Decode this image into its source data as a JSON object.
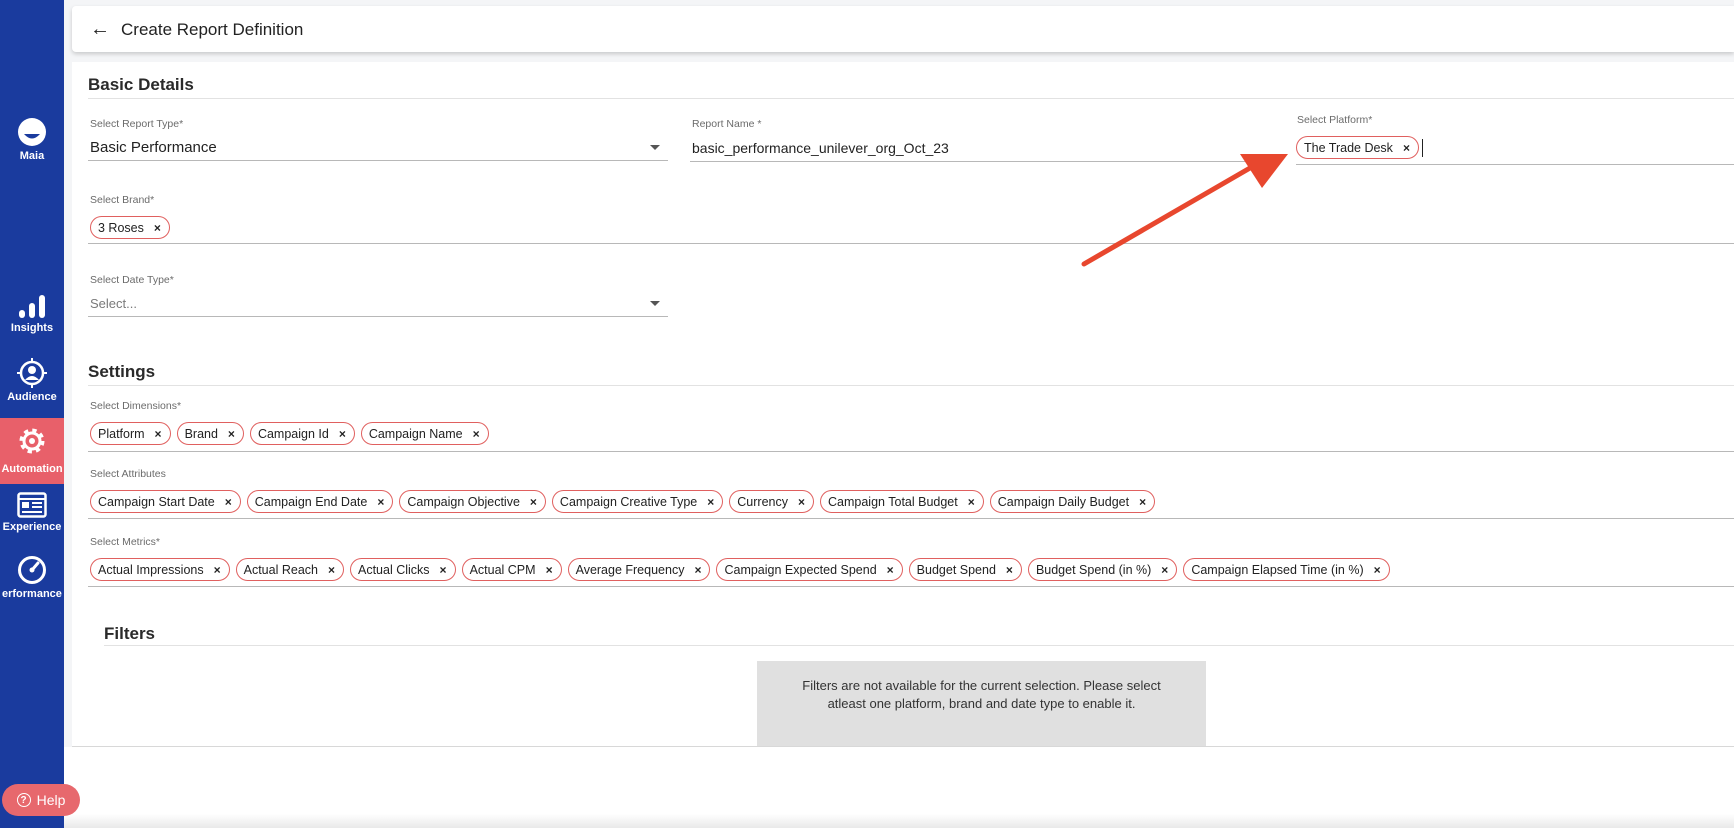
{
  "sidebar": {
    "items": [
      {
        "label": "Maia",
        "icon": "maia-logo-icon"
      },
      {
        "label": "Insights",
        "icon": "bar-chart-icon"
      },
      {
        "label": "Audience",
        "icon": "audience-target-icon"
      },
      {
        "label": "Automation",
        "icon": "gear-icon",
        "active": true
      },
      {
        "label": "Experience",
        "icon": "experience-layout-icon"
      },
      {
        "label": "erformance",
        "icon": "gauge-icon"
      }
    ],
    "help_label": "Help"
  },
  "header": {
    "title": "Create Report Definition",
    "back_icon": "arrow-left-icon"
  },
  "basic_details": {
    "title": "Basic Details",
    "report_type": {
      "label": "Select Report Type*",
      "value": "Basic Performance"
    },
    "report_name": {
      "label": "Report Name *",
      "value": "basic_performance_unilever_org_Oct_23"
    },
    "platform": {
      "label": "Select Platform*",
      "chips": [
        "The Trade Desk"
      ]
    },
    "brand": {
      "label": "Select Brand*",
      "chips": [
        "3 Roses"
      ]
    },
    "date_type": {
      "label": "Select Date Type*",
      "placeholder": "Select..."
    }
  },
  "settings": {
    "title": "Settings",
    "dimensions": {
      "label": "Select Dimensions*",
      "chips": [
        "Platform",
        "Brand",
        "Campaign Id",
        "Campaign Name"
      ]
    },
    "attributes": {
      "label": "Select Attributes",
      "chips": [
        "Campaign Start Date",
        "Campaign End Date",
        "Campaign Objective",
        "Campaign Creative Type",
        "Currency",
        "Campaign Total Budget",
        "Campaign Daily Budget"
      ]
    },
    "metrics": {
      "label": "Select Metrics*",
      "chips": [
        "Actual Impressions",
        "Actual Reach",
        "Actual Clicks",
        "Actual CPM",
        "Average Frequency",
        "Campaign Expected Spend",
        "Budget Spend",
        "Budget Spend (in %)",
        "Campaign Elapsed Time (in %)"
      ]
    }
  },
  "filters": {
    "title": "Filters",
    "notice": "Filters are not available for the current selection. Please select atleast one platform, brand and date type to enable it."
  },
  "colors": {
    "sidebar_bg": "#1a3b9e",
    "accent": "#e8606a",
    "chip_border": "#e0605f",
    "annotation_arrow": "#e8472e"
  }
}
